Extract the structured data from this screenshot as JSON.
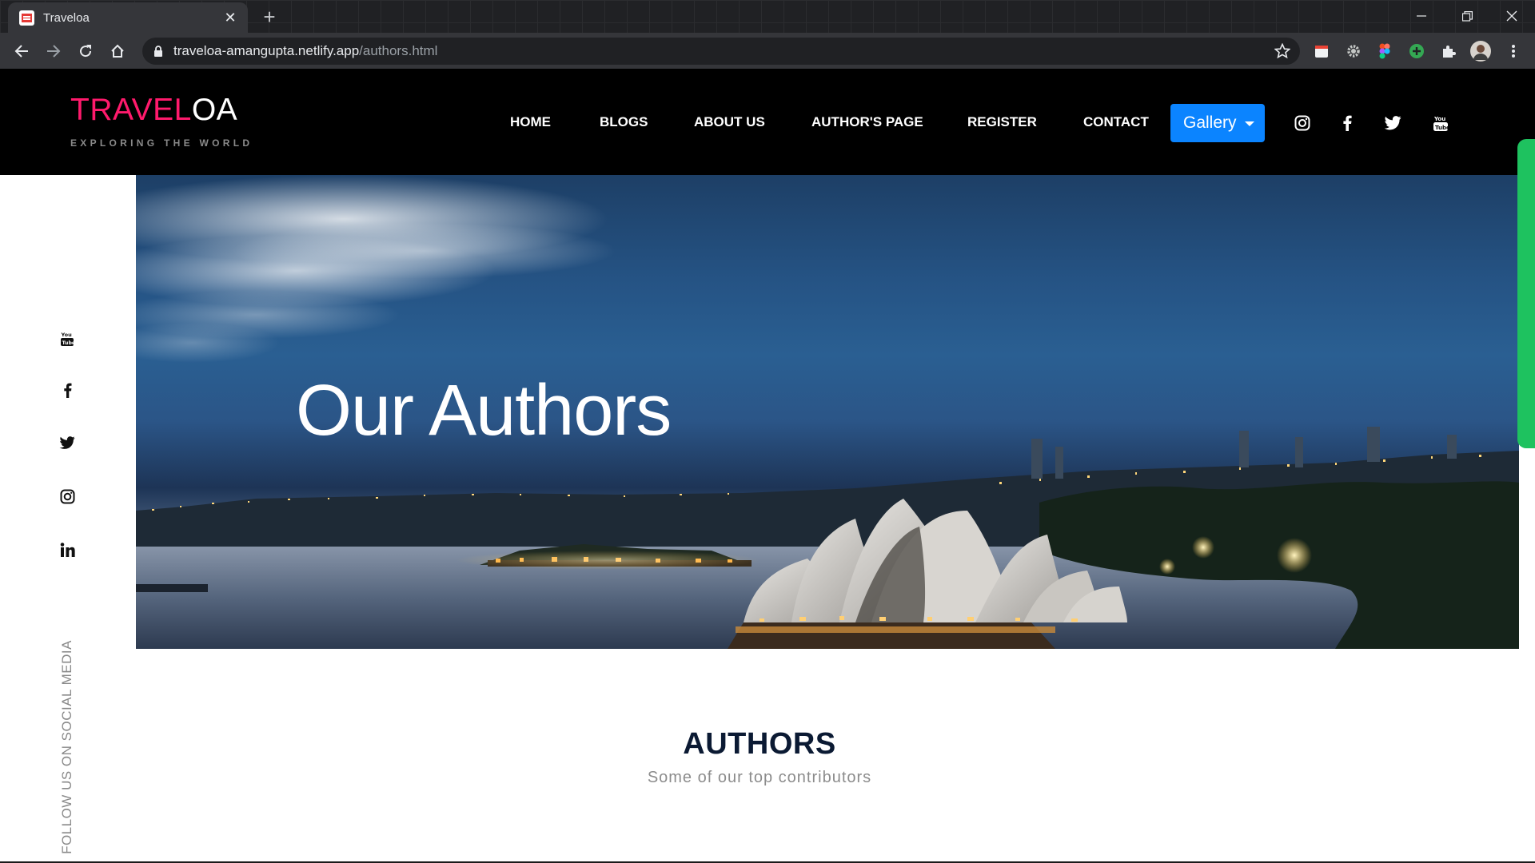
{
  "browser": {
    "tab_title": "Traveloa",
    "tab_close": "✕",
    "new_tab": "+",
    "url_domain": "traveloa-amangupta.netlify.app",
    "url_path": "/authors.html",
    "icons": [
      "back-icon",
      "forward-icon",
      "reload-icon",
      "home-icon",
      "lock-icon",
      "star-icon",
      "extension-icon",
      "profile-icon",
      "menu-icon"
    ]
  },
  "site": {
    "logo_part1": "TRAVEL",
    "logo_part2": "OA",
    "tagline": "EXPLORING THE WORLD",
    "nav": [
      "HOME",
      "BLOGS",
      "ABOUT US",
      "AUTHOR'S PAGE",
      "REGISTER",
      "CONTACT"
    ],
    "gallery_label": "Gallery",
    "colors": {
      "brand_pink": "#ff1a6c",
      "gallery_blue": "#0b84ff",
      "header_bg": "#000000"
    }
  },
  "hero": {
    "title": "Our Authors"
  },
  "sidebar": {
    "follow_text": "FOLLOW US ON SOCIAL MEDIA"
  },
  "authors_section": {
    "title": "AUTHORS",
    "subtitle": "Some of our top contributors"
  }
}
